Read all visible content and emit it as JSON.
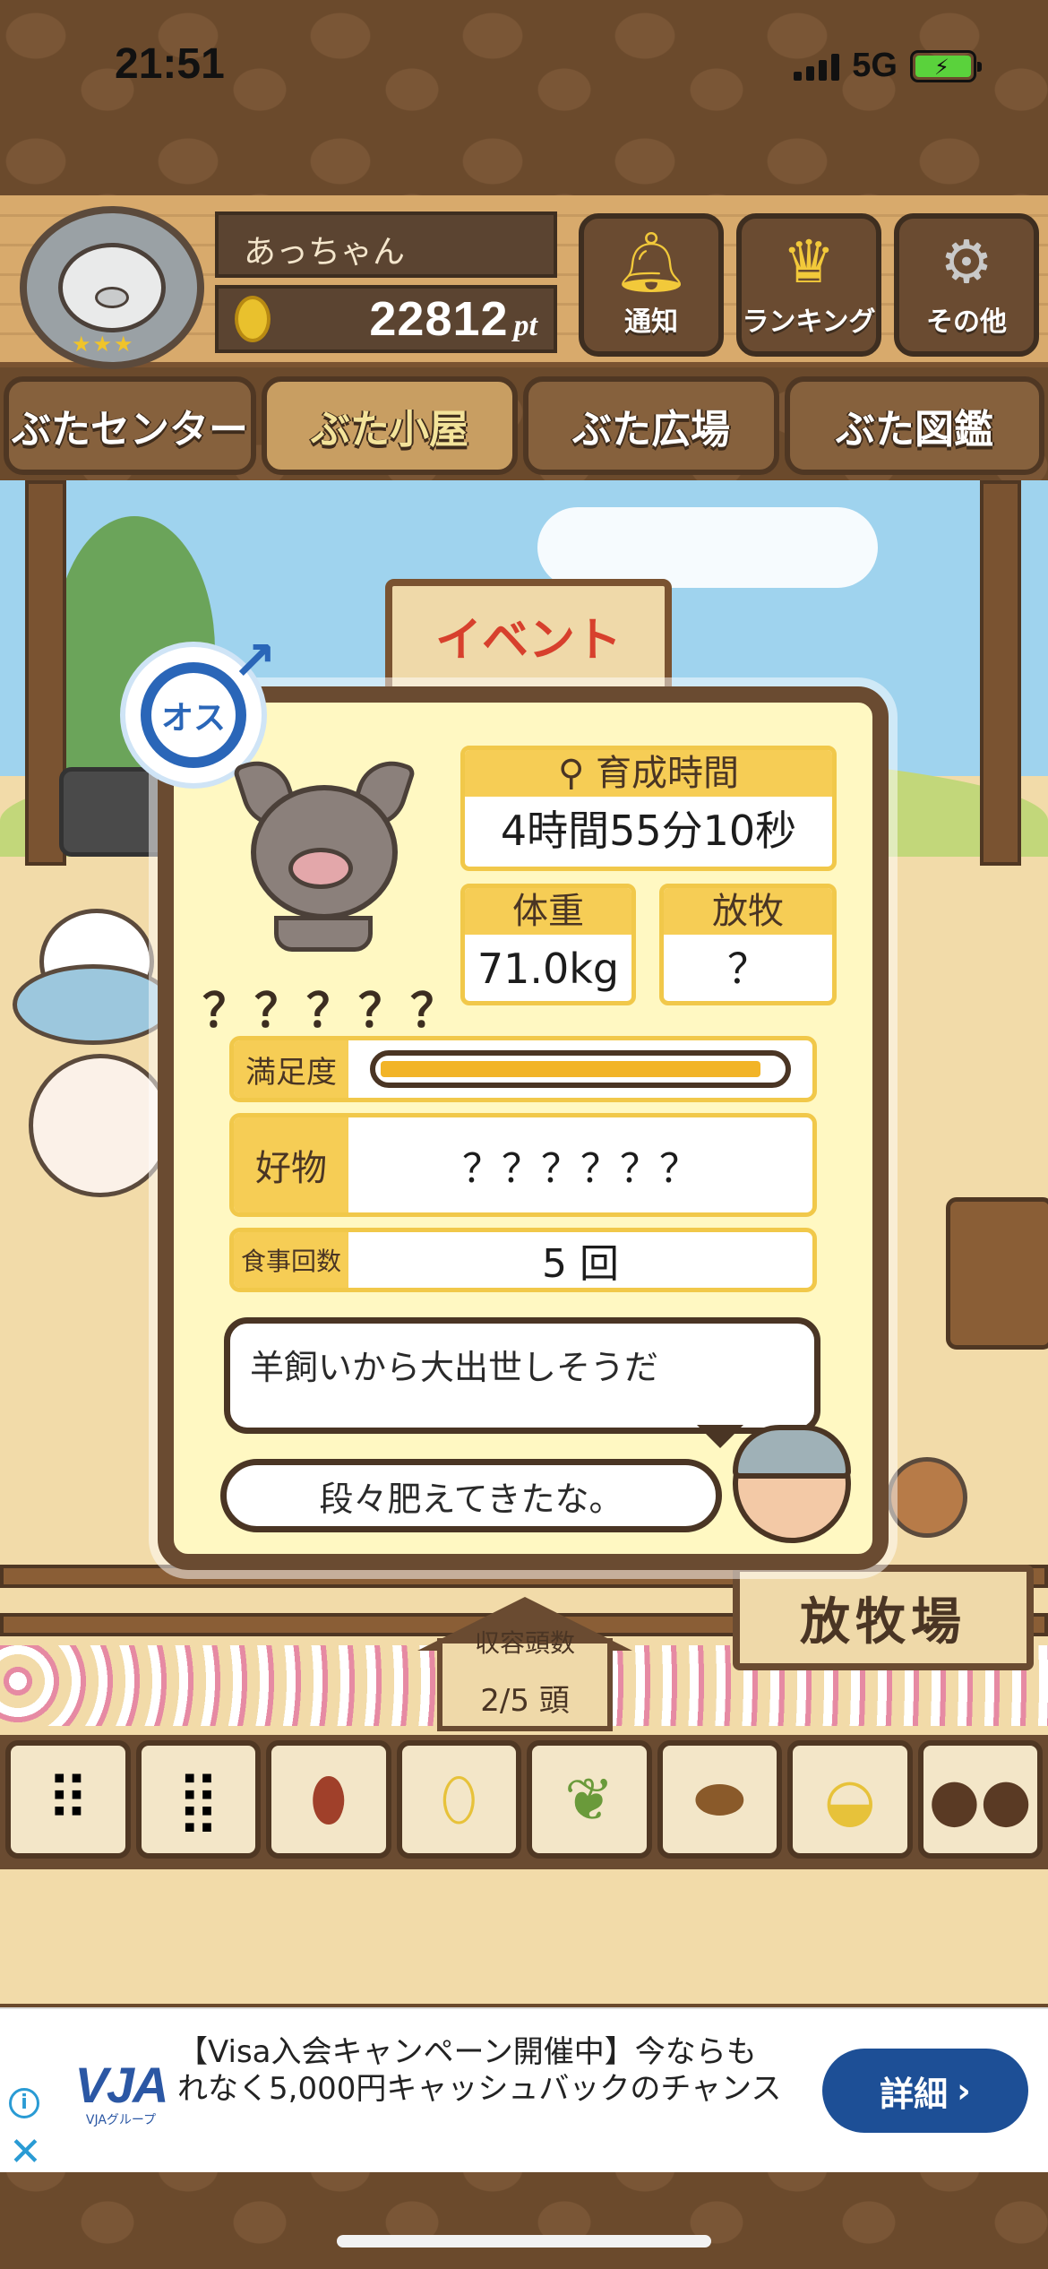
{
  "status_bar": {
    "time": "21:51",
    "network": "5G"
  },
  "header": {
    "player_name": "あっちゃん",
    "points_value": "22812",
    "points_unit": "pt",
    "buttons": [
      {
        "label": "通知",
        "icon": "bell-icon"
      },
      {
        "label": "ランキング",
        "icon": "crown-icon"
      },
      {
        "label": "その他",
        "icon": "gear-icon"
      }
    ]
  },
  "tabs": [
    {
      "label": "ぶたセンター"
    },
    {
      "label": "ぶた小屋",
      "selected": true
    },
    {
      "label": "ぶた広場"
    },
    {
      "label": "ぶた図鑑"
    }
  ],
  "scene": {
    "event_sign": "イベント",
    "pasture_sign": "放牧場",
    "capacity_label": "収容頭数",
    "capacity_value": "2/5 頭"
  },
  "pig_card": {
    "gender": "オス",
    "name": "？？？？？",
    "raising_time_label": "育成時間",
    "raising_time_value": "4時間55分10秒",
    "weight_label": "体重",
    "weight_value": "71.0kg",
    "grazing_label": "放牧",
    "grazing_value": "？",
    "satisfaction_label": "満足度",
    "satisfaction_level": 0.95,
    "favorite_label": "好物",
    "favorite_value": "？？？？？？",
    "meal_count_label": "食事回数",
    "meal_count_value": "5 回",
    "comment": "羊飼いから大出世しそうだ",
    "speech": "段々肥えてきたな。"
  },
  "food_items": [
    {
      "icon": "grain-pile-icon"
    },
    {
      "icon": "mixed-grain-icon"
    },
    {
      "icon": "sweet-potato-icon"
    },
    {
      "icon": "corn-icon"
    },
    {
      "icon": "beans-leaf-icon"
    },
    {
      "icon": "acorn-icon"
    },
    {
      "icon": "corn-bowl-icon"
    },
    {
      "icon": "chocolate-plate-icon"
    }
  ],
  "ad": {
    "logo": "VJA",
    "logo_sub": "VJAグループ",
    "text": "【Visa入会キャンペーン開催中】今ならもれなく5,000円キャッシュバックのチャンス",
    "cta": "詳細",
    "cta_arrow": "›"
  },
  "colors": {
    "frame_brown": "#6a4b31",
    "card_bg": "#fff8c2",
    "label_yellow": "#f6cd55",
    "satisfaction_fill": "#f2b427",
    "gender_blue": "#2a66b8",
    "ad_button": "#1d4f96"
  }
}
